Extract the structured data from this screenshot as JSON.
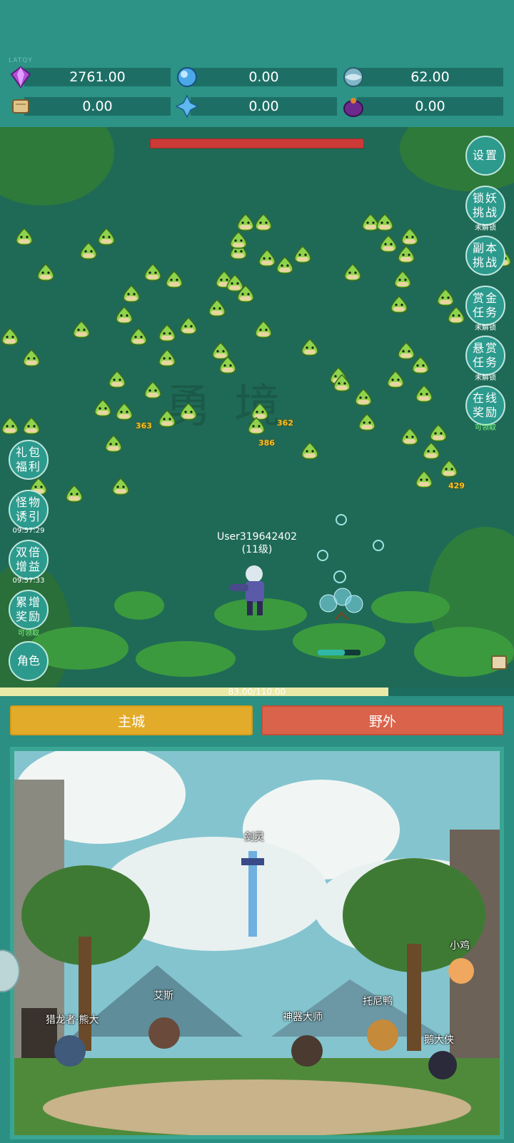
{
  "top": {
    "tiny_label": "LATQY",
    "resources": [
      {
        "icon": "purple-gem-icon",
        "value": "2761.00"
      },
      {
        "icon": "blue-crystal-icon",
        "value": "0.00"
      },
      {
        "icon": "globe-orb-icon",
        "value": "62.00"
      },
      {
        "icon": "scroll-icon",
        "value": "0.00"
      },
      {
        "icon": "ice-shard-icon",
        "value": "0.00"
      },
      {
        "icon": "purple-pouch-icon",
        "value": "0.00"
      }
    ]
  },
  "field": {
    "watermark": "勇 境",
    "damage_numbers": [
      "363",
      "362",
      "386",
      "429"
    ],
    "player_name": "User319642402",
    "player_level": "(11级)",
    "xp_text": "83.00/110.00",
    "xp_fraction": 0.755
  },
  "right_menu": [
    {
      "label": "设置",
      "sub": ""
    },
    {
      "label": "锁妖挑战",
      "sub": "未解锁"
    },
    {
      "label": "副本挑战",
      "sub": ""
    },
    {
      "label": "赏金任务",
      "sub": "未解锁"
    },
    {
      "label": "悬赏任务",
      "sub": "未解锁"
    },
    {
      "label": "在线奖励",
      "sub": "可领取"
    }
  ],
  "left_menu": [
    {
      "label": "礼包福利",
      "sub": ""
    },
    {
      "label": "怪物诱引",
      "sub": "09:57:29"
    },
    {
      "label": "双倍增益",
      "sub": "09:57:33"
    },
    {
      "label": "累增奖励",
      "sub": "可领取"
    },
    {
      "label": "角色",
      "sub": ""
    }
  ],
  "tabs": {
    "city": "主城",
    "wild": "野外"
  },
  "npcs": {
    "sword": "剑灵",
    "chick": "小鸡",
    "ace": "艾斯",
    "hunter": "猎龙者·熊大",
    "duck": "托尼鸭",
    "master": "神器大师",
    "goose": "鹅大侠"
  },
  "colors": {
    "accent": "#2c9386",
    "city_tab": "#e2ac2a",
    "wild_tab": "#d9634b",
    "boss_hp": "#cc3a38"
  }
}
